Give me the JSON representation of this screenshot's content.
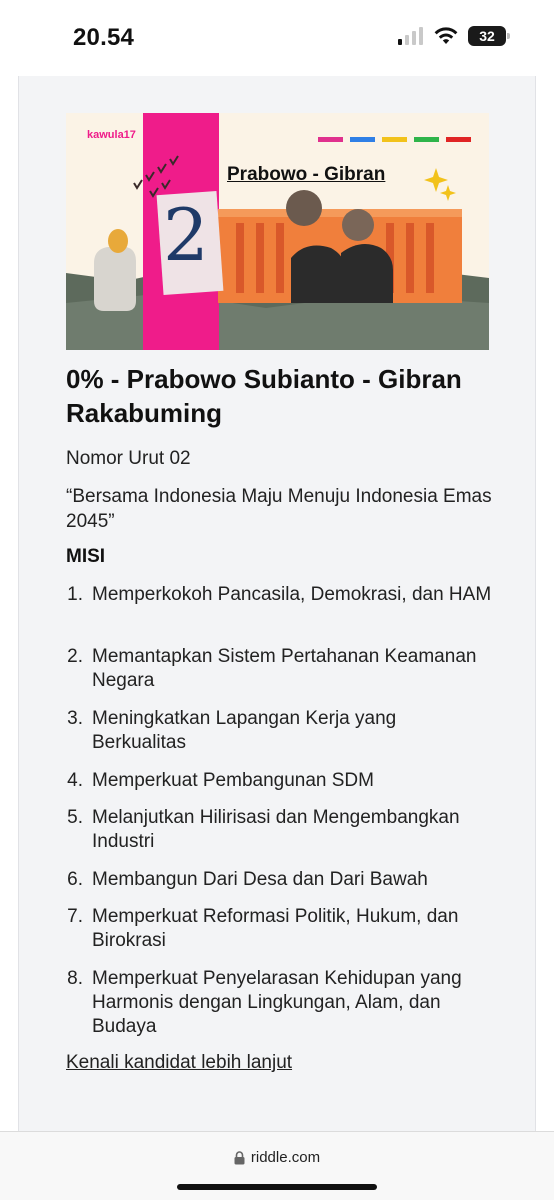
{
  "status": {
    "time": "20.54",
    "battery": "32"
  },
  "banner": {
    "brand": "kawula17",
    "candidates": "Prabowo - Gibran",
    "number": "2",
    "stripe_colors": [
      "#e0308d",
      "#2f7fe6",
      "#f2c21b",
      "#2fb44a",
      "#e02424"
    ]
  },
  "candidate": {
    "title": "0% - Prabowo Subianto - Gibran Rakabuming",
    "number_label": "Nomor Urut 02",
    "slogan": "“Bersama Indonesia Maju Menuju Indonesia Emas 2045”"
  },
  "misi": {
    "heading": "MISI",
    "items": [
      {
        "num": "1.",
        "text": "Memperkokoh Pancasila, Demokrasi, dan HAM"
      },
      {
        "num": "2.",
        "text": "Memantapkan Sistem Pertahanan Keamanan Negara"
      },
      {
        "num": "3.",
        "text": "Meningkatkan Lapangan Kerja yang Berkualitas"
      },
      {
        "num": "4.",
        "text": "Memperkuat Pembangunan SDM"
      },
      {
        "num": "5.",
        "text": "Melanjutkan Hilirisasi dan Mengembangkan Industri"
      },
      {
        "num": "6.",
        "text": "Membangun Dari Desa dan Dari Bawah"
      },
      {
        "num": "7.",
        "text": "Memperkuat Reformasi Politik, Hukum, dan Birokrasi"
      },
      {
        "num": "8.",
        "text": "Memperkuat Penyelarasan Kehidupan yang Harmonis dengan Lingkungan, Alam, dan Budaya"
      }
    ]
  },
  "link": {
    "label": "Kenali kandidat lebih lanjut"
  },
  "browser": {
    "url": "riddle.com"
  },
  "colors": {
    "accent_pink": "#ef1c8a",
    "banner_bg": "#fbf3e6",
    "palace_orange": "#f07f3c"
  }
}
